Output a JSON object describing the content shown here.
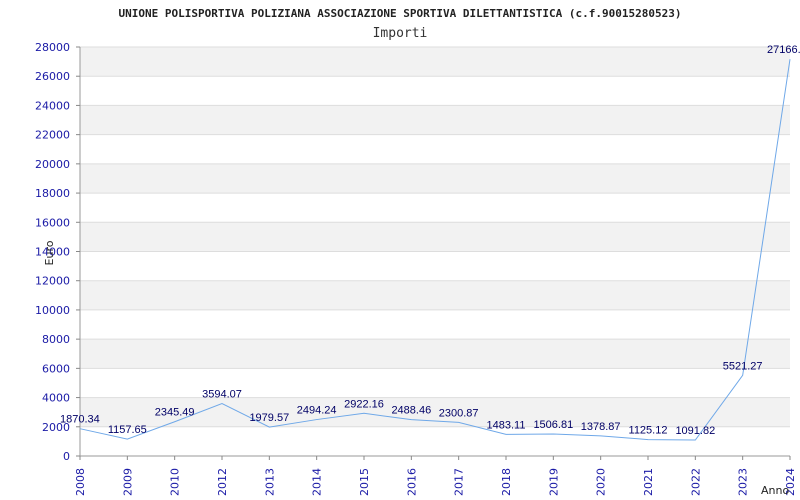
{
  "chart_data": {
    "type": "line",
    "title": "UNIONE POLISPORTIVA POLIZIANA ASSOCIAZIONE SPORTIVA DILETTANTISTICA (c.f.90015280523)",
    "subtitle": "Importi",
    "xlabel": "Anno",
    "ylabel": "Euro",
    "ylim": [
      0,
      28000
    ],
    "yticks": [
      "0",
      "2000",
      "4000",
      "6000",
      "8000",
      "10000",
      "12000",
      "14000",
      "16000",
      "18000",
      "20000",
      "22000",
      "24000",
      "26000",
      "28000"
    ],
    "categories": [
      "2008",
      "2009",
      "2010",
      "2012",
      "2013",
      "2014",
      "2015",
      "2016",
      "2017",
      "2018",
      "2019",
      "2020",
      "2021",
      "2022",
      "2023",
      "2024"
    ],
    "values": [
      1870.34,
      1157.65,
      2345.49,
      3594.07,
      1979.57,
      2494.24,
      2922.16,
      2488.46,
      2300.87,
      1483.11,
      1506.81,
      1378.87,
      1125.12,
      1091.82,
      5521.27,
      27166
    ],
    "labels": [
      "1870.34",
      "1157.65",
      "2345.49",
      "3594.07",
      "1979.57",
      "2494.24",
      "2922.16",
      "2488.46",
      "2300.87",
      "1483.11",
      "1506.81",
      "1378.87",
      "1125.12",
      "1091.82",
      "5521.27",
      "27166."
    ],
    "grid": true,
    "colors": {
      "line": "#6fa8e8",
      "band": "#f2f2f2",
      "grid": "#dddddd",
      "tick": "#1a1aa6"
    }
  }
}
